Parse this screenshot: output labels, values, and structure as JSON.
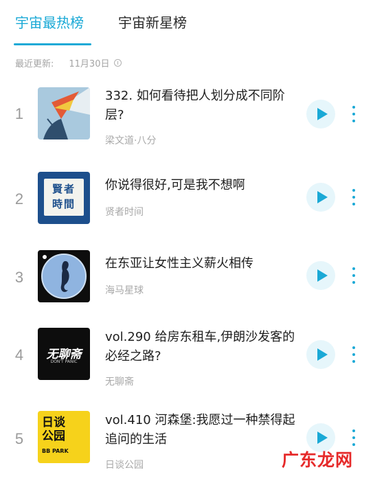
{
  "tabs": [
    {
      "label": "宇宙最热榜",
      "active": true
    },
    {
      "label": "宇宙新星榜",
      "active": false
    }
  ],
  "update": {
    "label": "最近更新:",
    "date": "11月30日"
  },
  "accent_color": "#1aa9d6",
  "items": [
    {
      "rank": "1",
      "title": "332. 如何看待把人划分成不同阶层?",
      "author": "梁文道·八分"
    },
    {
      "rank": "2",
      "title": "你说得很好,可是我不想啊",
      "author": "贤者时间"
    },
    {
      "rank": "3",
      "title": "在东亚让女性主义薪火相传",
      "author": "海马星球"
    },
    {
      "rank": "4",
      "title": "vol.290 给房东租车,伊朗沙发客的必经之路?",
      "author": "无聊斋"
    },
    {
      "rank": "5",
      "title": "vol.410 河森堡:我愿过一种禁得起追问的生活",
      "author": "日谈公园"
    }
  ],
  "covers": {
    "c2": {
      "line1": "賢者",
      "line2": "時間"
    },
    "c4": {
      "main": "无聊斋",
      "sub": "DON'T PANIC"
    },
    "c5": {
      "line1": "日谈",
      "line2": "公园",
      "line3": "BB PARK"
    }
  },
  "watermark": "广东龙网"
}
